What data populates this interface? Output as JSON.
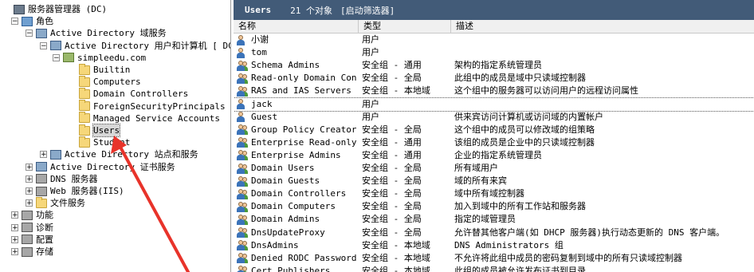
{
  "tree": [
    {
      "label": "服务器管理器 (DC)",
      "level": 0,
      "expander": "",
      "icon": "server-manager-icon"
    },
    {
      "label": "角色",
      "level": 1,
      "expander": "−",
      "icon": "roles-icon"
    },
    {
      "label": "Active Directory 域服务",
      "level": 2,
      "expander": "−",
      "icon": "ad-ds-icon"
    },
    {
      "label": "Active Directory 用户和计算机 [ DC.s",
      "level": 3,
      "expander": "−",
      "icon": "ad-users-computers-icon"
    },
    {
      "label": "simpleedu.com",
      "level": 4,
      "expander": "−",
      "icon": "domain-icon"
    },
    {
      "label": "Builtin",
      "level": 5,
      "expander": "",
      "icon": "folder-icon"
    },
    {
      "label": "Computers",
      "level": 5,
      "expander": "",
      "icon": "folder-icon"
    },
    {
      "label": "Domain Controllers",
      "level": 5,
      "expander": "",
      "icon": "folder-icon"
    },
    {
      "label": "ForeignSecurityPrincipals",
      "level": 5,
      "expander": "",
      "icon": "folder-icon"
    },
    {
      "label": "Managed Service Accounts",
      "level": 5,
      "expander": "",
      "icon": "folder-icon"
    },
    {
      "label": "Users",
      "level": 5,
      "expander": "",
      "icon": "folder-icon",
      "selected": true
    },
    {
      "label": "Student",
      "level": 5,
      "expander": "",
      "icon": "folder-icon"
    },
    {
      "label": "Active Directory 站点和服务",
      "level": 3,
      "expander": "+",
      "icon": "ad-sites-icon"
    },
    {
      "label": "Active Directory 证书服务",
      "level": 2,
      "expander": "+",
      "icon": "ad-cs-icon"
    },
    {
      "label": "DNS 服务器",
      "level": 2,
      "expander": "+",
      "icon": "dns-icon"
    },
    {
      "label": "Web 服务器(IIS)",
      "level": 2,
      "expander": "+",
      "icon": "iis-icon"
    },
    {
      "label": "文件服务",
      "level": 2,
      "expander": "+",
      "icon": "file-services-icon"
    },
    {
      "label": "功能",
      "level": 1,
      "expander": "+",
      "icon": "features-icon"
    },
    {
      "label": "诊断",
      "level": 1,
      "expander": "+",
      "icon": "diagnostics-icon"
    },
    {
      "label": "配置",
      "level": 1,
      "expander": "+",
      "icon": "configuration-icon"
    },
    {
      "label": "存储",
      "level": 1,
      "expander": "+",
      "icon": "storage-icon"
    }
  ],
  "panel": {
    "title": "Users",
    "count": "21 个对象",
    "filter": "[启动筛选器]"
  },
  "columns": {
    "name": "名称",
    "type": "类型",
    "desc": "描述"
  },
  "rows": [
    {
      "name": "小谢",
      "type": "用户",
      "desc": "",
      "kind": "user"
    },
    {
      "name": "tom",
      "type": "用户",
      "desc": "",
      "kind": "user"
    },
    {
      "name": "Schema Admins",
      "type": "安全组 - 通用",
      "desc": "架构的指定系统管理员",
      "kind": "group"
    },
    {
      "name": "Read-only Domain Con...",
      "type": "安全组 - 全局",
      "desc": "此组中的成员是域中只读域控制器",
      "kind": "group"
    },
    {
      "name": "RAS and IAS Servers",
      "type": "安全组 - 本地域",
      "desc": "这个组中的服务器可以访问用户的远程访问属性",
      "kind": "group"
    },
    {
      "name": "jack",
      "type": "用户",
      "desc": "",
      "kind": "user",
      "selected": true
    },
    {
      "name": "Guest",
      "type": "用户",
      "desc": "供来宾访问计算机或访问域的内置帐户",
      "kind": "user"
    },
    {
      "name": "Group Policy Creator...",
      "type": "安全组 - 全局",
      "desc": "这个组中的成员可以修改域的组策略",
      "kind": "group"
    },
    {
      "name": "Enterprise Read-only...",
      "type": "安全组 - 通用",
      "desc": "该组的成员是企业中的只读域控制器",
      "kind": "group"
    },
    {
      "name": "Enterprise Admins",
      "type": "安全组 - 通用",
      "desc": "企业的指定系统管理员",
      "kind": "group"
    },
    {
      "name": "Domain Users",
      "type": "安全组 - 全局",
      "desc": "所有域用户",
      "kind": "group"
    },
    {
      "name": "Domain Guests",
      "type": "安全组 - 全局",
      "desc": "域的所有来宾",
      "kind": "group"
    },
    {
      "name": "Domain Controllers",
      "type": "安全组 - 全局",
      "desc": "域中所有域控制器",
      "kind": "group"
    },
    {
      "name": "Domain Computers",
      "type": "安全组 - 全局",
      "desc": "加入到域中的所有工作站和服务器",
      "kind": "group"
    },
    {
      "name": "Domain Admins",
      "type": "安全组 - 全局",
      "desc": "指定的域管理员",
      "kind": "group"
    },
    {
      "name": "DnsUpdateProxy",
      "type": "安全组 - 全局",
      "desc": "允许替其他客户端(如 DHCP 服务器)执行动态更新的 DNS 客户端。",
      "kind": "group"
    },
    {
      "name": "DnsAdmins",
      "type": "安全组 - 本地域",
      "desc": "DNS Administrators 组",
      "kind": "group"
    },
    {
      "name": "Denied RODC Password...",
      "type": "安全组 - 本地域",
      "desc": "不允许将此组中成员的密码复制到域中的所有只读域控制器",
      "kind": "group"
    },
    {
      "name": "Cert Publishers",
      "type": "安全组 - 本地域",
      "desc": "此组的成员被允许发布证书到目录",
      "kind": "group"
    }
  ],
  "colors": {
    "title_bar": "#425b78",
    "arrow": "#e8332a",
    "selection": "#d7d7d7"
  }
}
